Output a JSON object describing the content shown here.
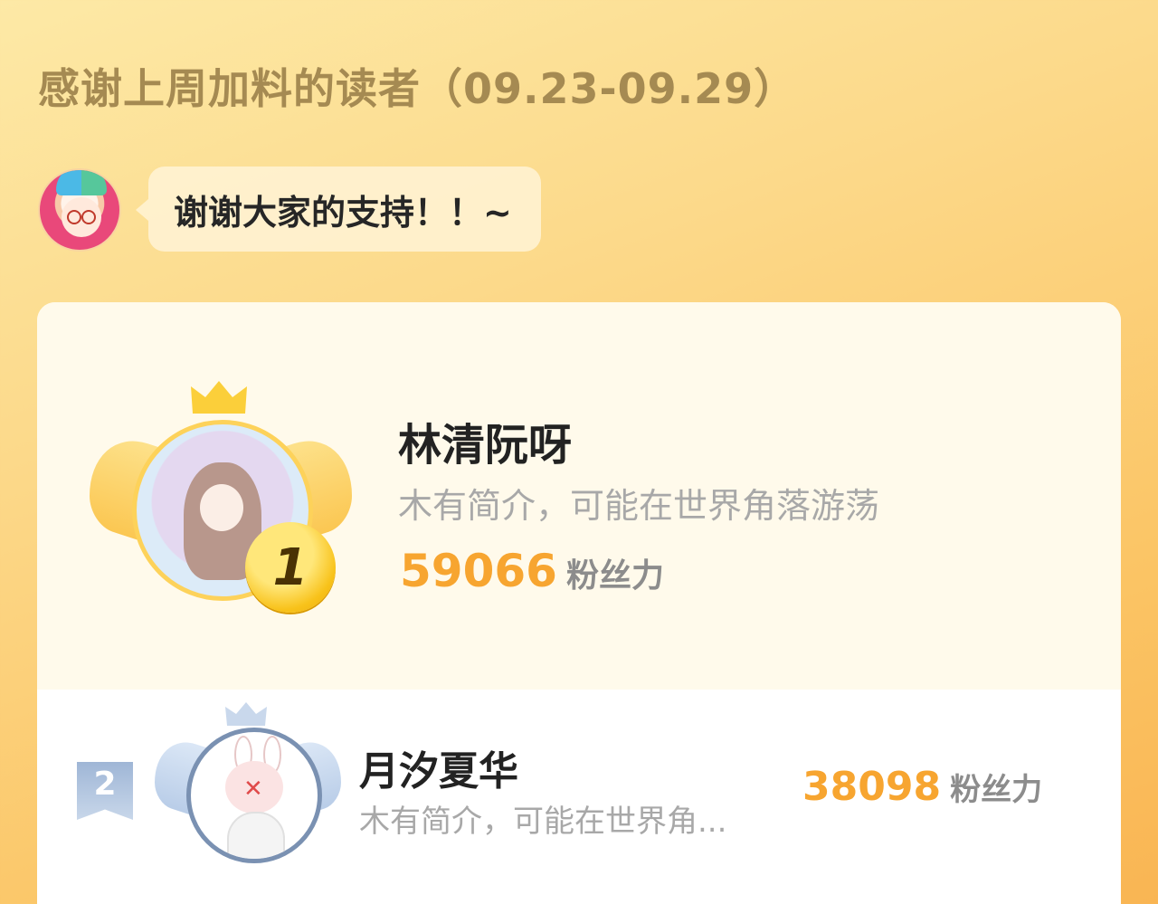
{
  "header": {
    "title": "感谢上周加料的读者（09.23-09.29）"
  },
  "message": {
    "avatar_icon": "jester-girl-avatar",
    "text": "谢谢大家的支持！！~"
  },
  "colors": {
    "background": "#fcd98a",
    "score": "#f7a530",
    "rank1_ring": "#fdd25a",
    "rank2_ring": "#7a91b2"
  },
  "ranking": [
    {
      "rank": "1",
      "name": "林清阮呀",
      "bio": "木有简介，可能在世界角落游荡",
      "score": "59066",
      "score_unit": "粉丝力",
      "badge_icon": "gold-medal-icon",
      "crown_icon": "gold-crown-icon"
    },
    {
      "rank": "2",
      "name": "月汐夏华",
      "bio": "木有简介，可能在世界角...",
      "score": "38098",
      "score_unit": "粉丝力",
      "badge_icon": "silver-ribbon-icon",
      "crown_icon": "silver-crown-icon"
    }
  ]
}
